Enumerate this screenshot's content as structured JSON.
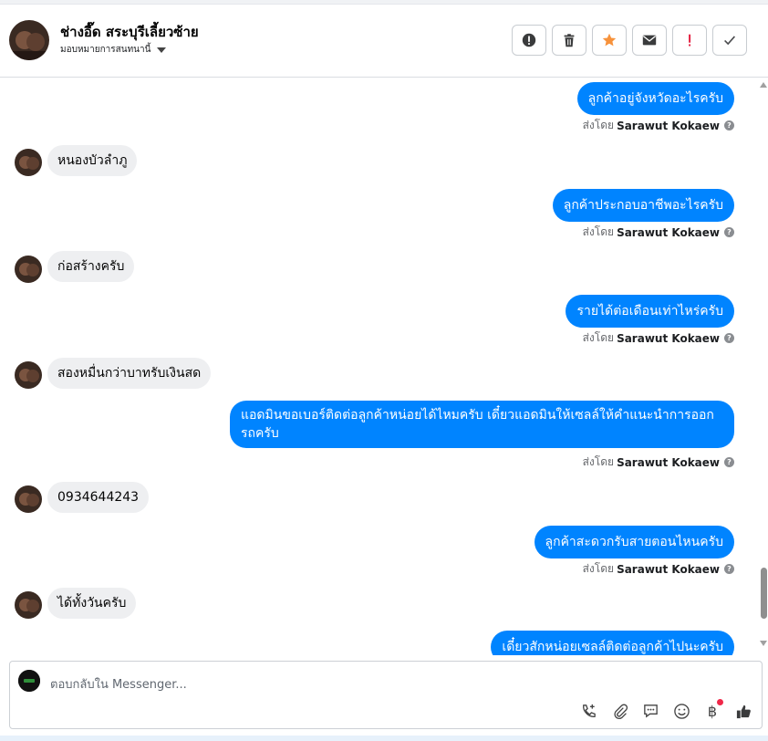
{
  "header": {
    "contact_name": "ช่างอี๊ด สระบุรีเลี้ยวซ้าย",
    "assign_label": "มอบหมายการสนทนานี้"
  },
  "actions": [
    {
      "name": "mark-spam-button",
      "icon": "alert-circle-icon"
    },
    {
      "name": "delete-button",
      "icon": "trash-icon"
    },
    {
      "name": "star-button",
      "icon": "star-icon",
      "color": "#f7923b"
    },
    {
      "name": "mark-unread-button",
      "icon": "envelope-icon"
    },
    {
      "name": "follow-up-button",
      "icon": "exclamation-icon",
      "color": "#e41e3f"
    },
    {
      "name": "mark-done-button",
      "icon": "check-icon"
    }
  ],
  "sender_label": "ส่งโดย",
  "sender_name": "Sarawut Kokaew",
  "messages": [
    {
      "dir": "out",
      "text": "ลูกค้าอยู่จังหวัดอะไรครับ"
    },
    {
      "dir": "in",
      "text": "หนองบัวลำภู"
    },
    {
      "dir": "out",
      "text": "ลูกค้าประกอบอาชีพอะไรครับ"
    },
    {
      "dir": "in",
      "text": "ก่อสร้างครับ"
    },
    {
      "dir": "out",
      "text": "รายได้ต่อเดือนเท่าไหร่ครับ"
    },
    {
      "dir": "in",
      "text": "สองหมื่นกว่าบาทรับเงินสด"
    },
    {
      "dir": "out",
      "text": "แอดมินขอเบอร์ติดต่อลูกค้าหน่อยได้ไหมครับ เดี๋ยวแอดมินให้เซลล์ให้คำแนะนำการออกรถครับ"
    },
    {
      "dir": "in",
      "text": "0934644243"
    },
    {
      "dir": "out",
      "text": "ลูกค้าสะดวกรับสายตอนไหนครับ"
    },
    {
      "dir": "in",
      "text": "ได้ทั้งวันครับ"
    },
    {
      "dir": "out",
      "text": "เดี๋ยวสักหน่อยเซลล์ติดต่อลูกค้าไปนะครับ"
    }
  ],
  "composer": {
    "placeholder": "ตอบกลับใน Messenger..."
  },
  "colors": {
    "outgoing_bubble": "#0084ff",
    "incoming_bubble": "#eeeff1"
  }
}
